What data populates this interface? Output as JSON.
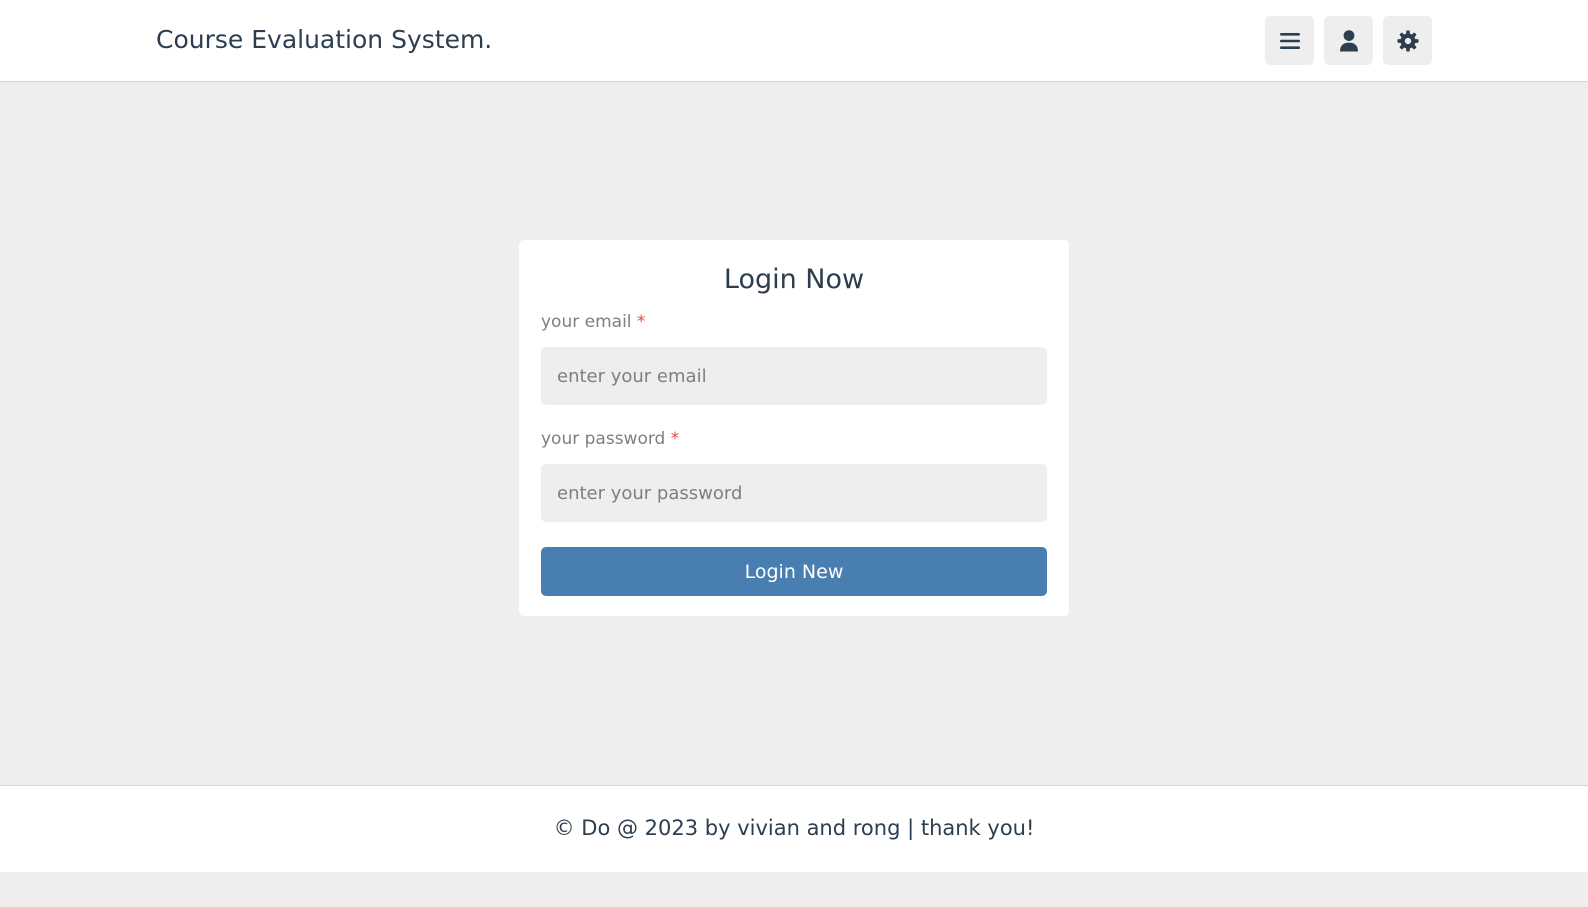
{
  "header": {
    "logo": "Course Evaluation System.",
    "buttons": [
      {
        "icon": "menu-bars-icon"
      },
      {
        "icon": "user-icon"
      },
      {
        "icon": "gear-icon"
      }
    ]
  },
  "login": {
    "title": "Login Now",
    "email_label": "your email",
    "email_placeholder": "enter your email",
    "email_value": "",
    "password_label": "your password",
    "password_placeholder": "enter your password",
    "password_value": "",
    "required_marker": "*",
    "submit_label": "Login New"
  },
  "footer": {
    "text": "© Do @ 2023 by vivian and rong | thank you!"
  },
  "colors": {
    "accent": "#487eb0",
    "text": "#2c3e50",
    "muted": "#7f7f7f",
    "required": "#e74c3c",
    "background": "#eeeeee",
    "surface": "#ffffff"
  }
}
